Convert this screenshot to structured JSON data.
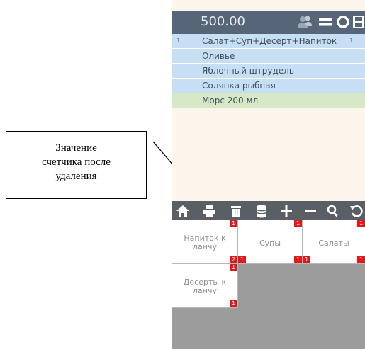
{
  "callout": {
    "line1": "Значение",
    "line2": "счетчика после",
    "line3": "удаления"
  },
  "topbar": {
    "total": "500.00",
    "icons": [
      "users-icon",
      "menu-icon",
      "settings-icon",
      "save-icon"
    ]
  },
  "order": {
    "header": {
      "num": "1",
      "name": "Салат+Суп+Десерт+Напиток",
      "qty": "1"
    },
    "items": [
      "Оливье",
      "Яблочный штрудель",
      "Солянка рыбная",
      "Морс 200 мл"
    ]
  },
  "toolbar": {
    "icons": [
      "home-icon",
      "print-icon",
      "trash-icon",
      "database-icon",
      "plus-icon",
      "minus-icon",
      "search-icon",
      "refresh-icon"
    ]
  },
  "tiles": [
    {
      "label1": "Напиток к",
      "label2": "ланчу",
      "badge_top": "1",
      "badge_bottom": "2"
    },
    {
      "label1": "Супы",
      "badge_top": "1",
      "badge_bottom_left": "1",
      "badge_bottom": "1"
    },
    {
      "label1": "Салаты",
      "badge_top": "1",
      "badge_bottom_left": "1",
      "badge_bottom": "1"
    },
    {
      "label1": "Десерты к",
      "label2": "ланчу",
      "badge_top": "1",
      "badge_bottom": "1"
    }
  ],
  "colors": {
    "topbar": "#566577",
    "toolbar": "#5a5f66",
    "badge": "#e01a1a",
    "item_blue": "#c7dff5",
    "item_green": "#d6e8c6"
  }
}
